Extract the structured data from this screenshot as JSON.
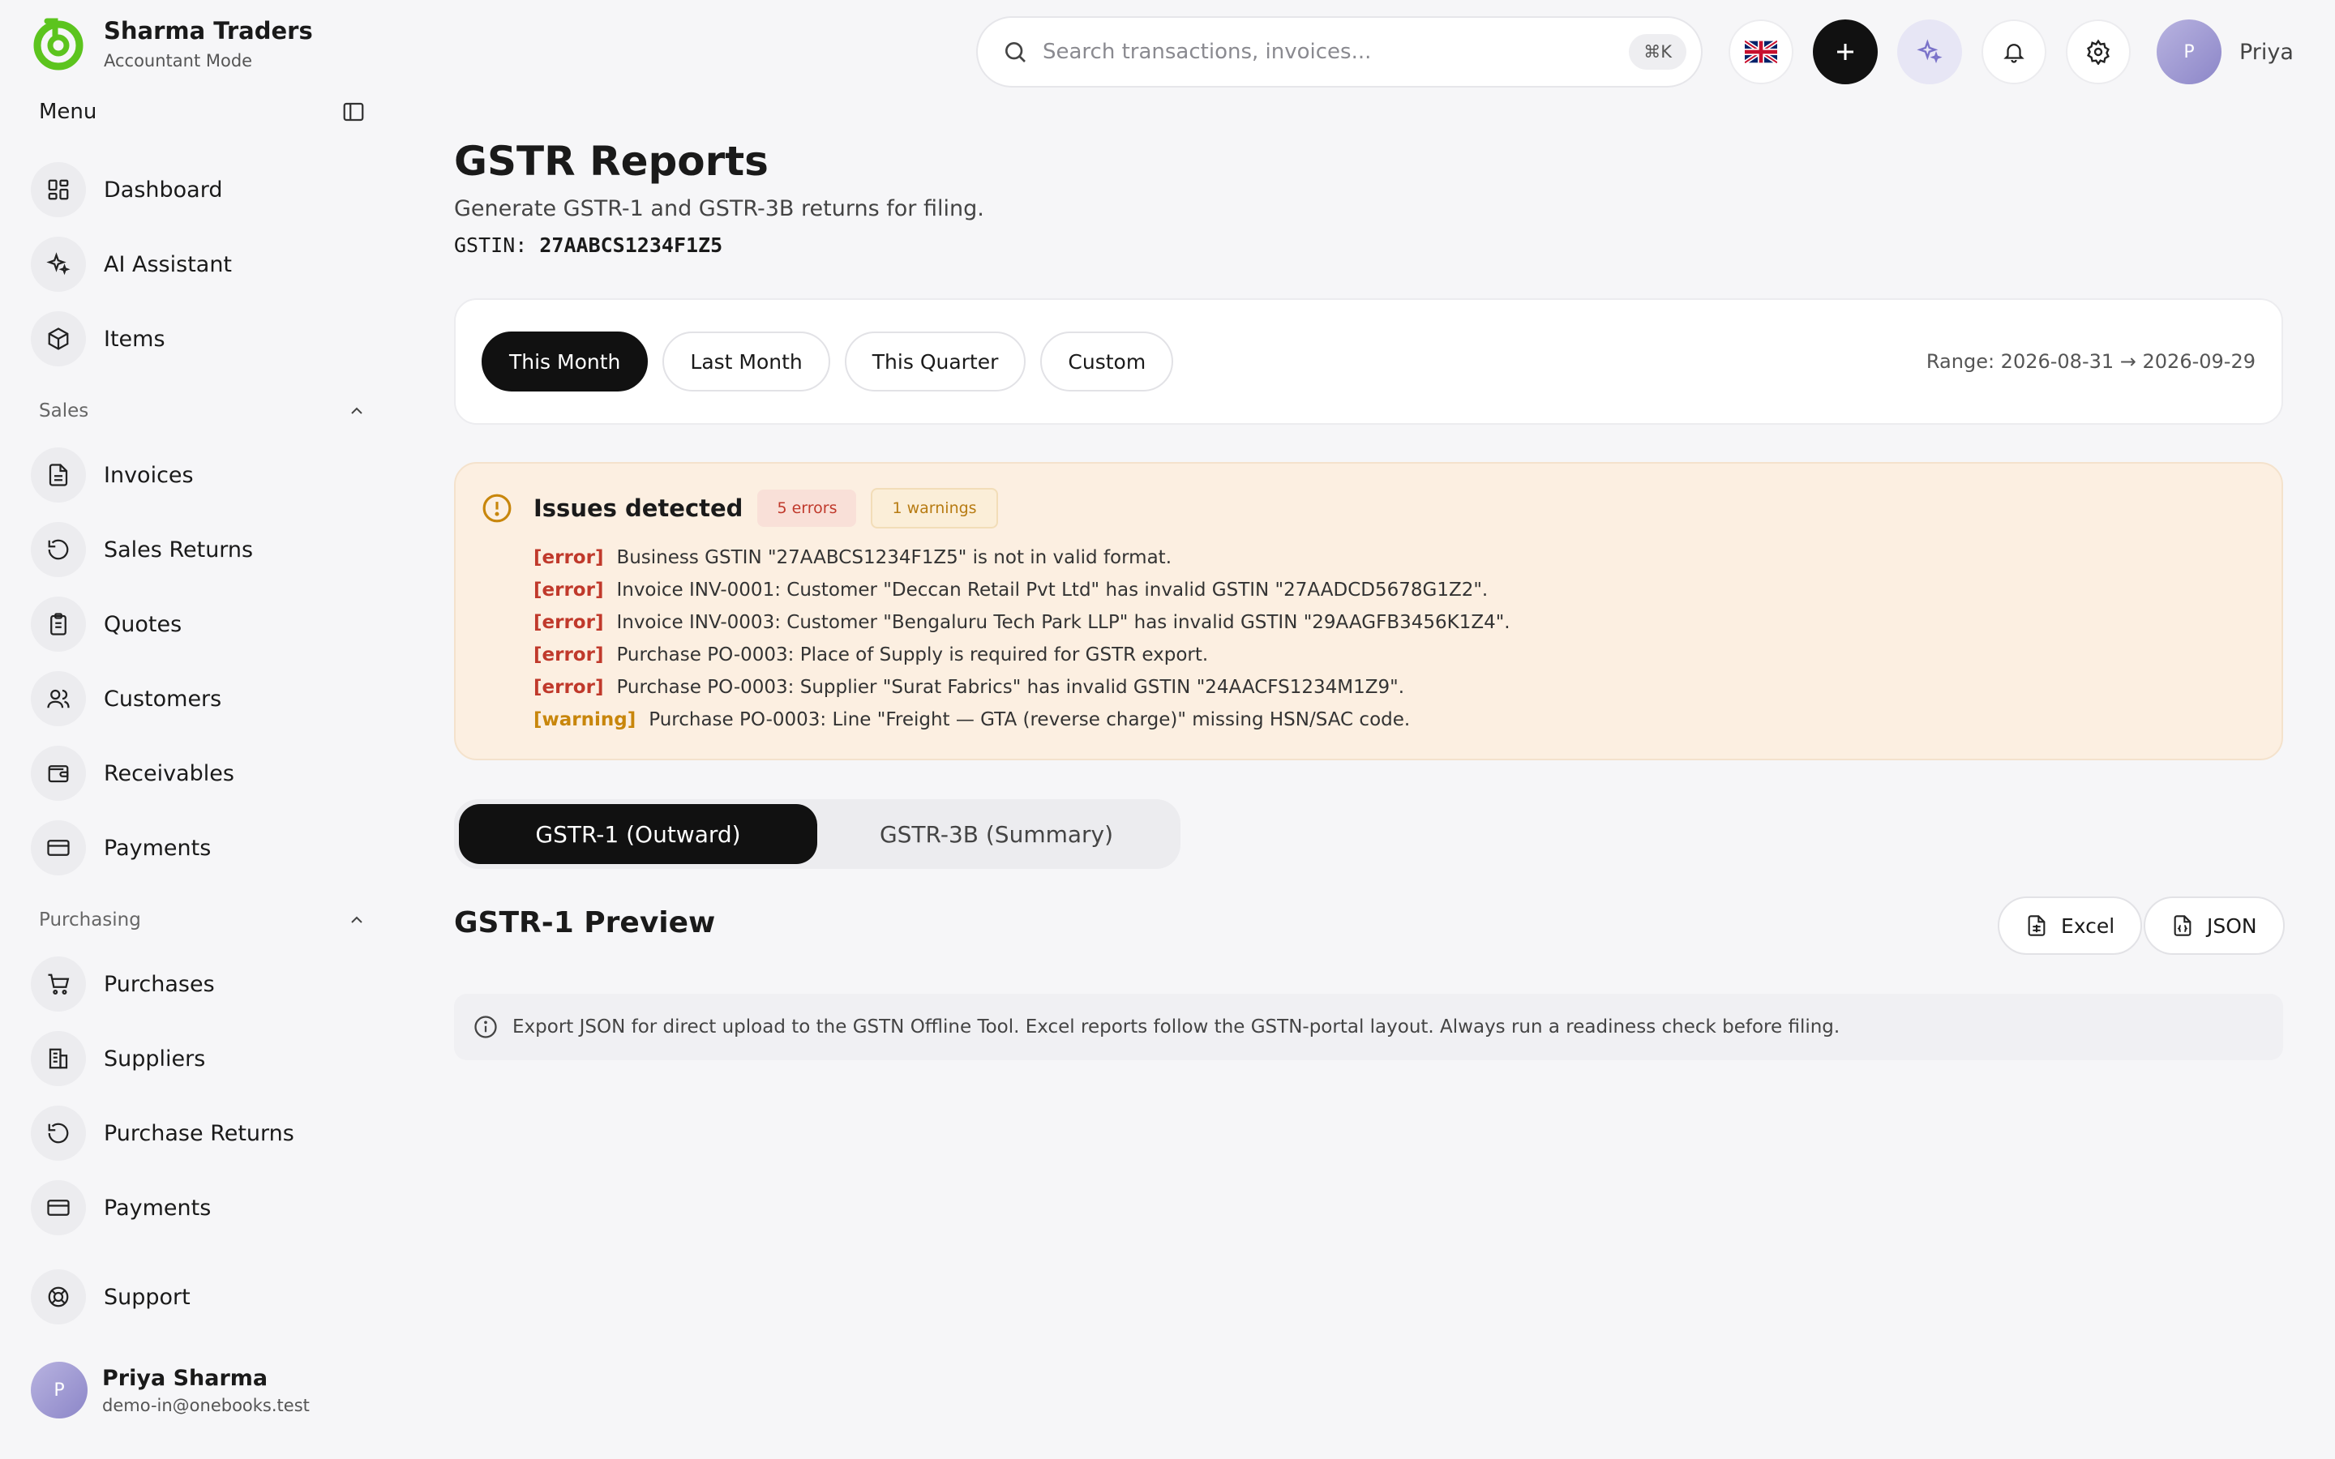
{
  "brand": {
    "name": "Sharma Traders",
    "mode": "Accountant Mode",
    "accent": "#5cc41e"
  },
  "menu": {
    "title": "Menu"
  },
  "nav_top": [
    {
      "label": "Dashboard",
      "icon": "dashboard-icon"
    },
    {
      "label": "AI Assistant",
      "icon": "sparkles-icon"
    },
    {
      "label": "Items",
      "icon": "box-icon"
    }
  ],
  "sales": {
    "label": "Sales",
    "items": [
      {
        "label": "Invoices",
        "icon": "document-icon"
      },
      {
        "label": "Sales Returns",
        "icon": "return-icon"
      },
      {
        "label": "Quotes",
        "icon": "clipboard-icon"
      },
      {
        "label": "Customers",
        "icon": "users-icon"
      },
      {
        "label": "Receivables",
        "icon": "wallet-icon"
      },
      {
        "label": "Payments",
        "icon": "card-icon"
      }
    ]
  },
  "purchasing": {
    "label": "Purchasing",
    "items": [
      {
        "label": "Purchases",
        "icon": "cart-icon"
      },
      {
        "label": "Suppliers",
        "icon": "building-icon"
      },
      {
        "label": "Purchase Returns",
        "icon": "return-icon"
      },
      {
        "label": "Payments",
        "icon": "card-icon"
      }
    ]
  },
  "support": {
    "label": "Support",
    "icon": "lifebuoy-icon"
  },
  "user": {
    "initial": "P",
    "name": "Priya Sharma",
    "email": "demo-in@onebooks.test",
    "short_name": "Priya"
  },
  "search": {
    "placeholder": "Search transactions, invoices...",
    "shortcut": "⌘K"
  },
  "page": {
    "title": "GSTR Reports",
    "subtitle": "Generate GSTR-1 and GSTR-3B returns for filing.",
    "gstin_label": "GSTIN:",
    "gstin_value": "27AABCS1234F1Z5"
  },
  "range": {
    "options": [
      "This Month",
      "Last Month",
      "This Quarter",
      "Custom"
    ],
    "selected": "This Month",
    "text": "Range: 2026-08-31 → 2026-09-29"
  },
  "issues": {
    "title": "Issues detected",
    "errors_badge": "5 errors",
    "warnings_badge": "1 warnings",
    "list": [
      {
        "type": "[error]",
        "text": "Business GSTIN \"27AABCS1234F1Z5\" is not in valid format."
      },
      {
        "type": "[error]",
        "text": "Invoice INV-0001: Customer \"Deccan Retail Pvt Ltd\" has invalid GSTIN \"27AADCD5678G1Z2\"."
      },
      {
        "type": "[error]",
        "text": "Invoice INV-0003: Customer \"Bengaluru Tech Park LLP\" has invalid GSTIN \"29AAGFB3456K1Z4\"."
      },
      {
        "type": "[error]",
        "text": "Purchase PO-0003: Place of Supply is required for GSTR export."
      },
      {
        "type": "[error]",
        "text": "Purchase PO-0003: Supplier \"Surat Fabrics\" has invalid GSTIN \"24AACFS1234M1Z9\"."
      },
      {
        "type": "[warning]",
        "text": "Purchase PO-0003: Line \"Freight — GTA (reverse charge)\" missing HSN/SAC code."
      }
    ]
  },
  "report_tabs": {
    "active": "GSTR-1 (Outward)",
    "inactive": "GSTR-3B (Summary)"
  },
  "preview": {
    "title": "GSTR-1 Preview",
    "excel_label": "Excel",
    "json_label": "JSON"
  },
  "info": {
    "text": "Export JSON for direct upload to the GSTN Offline Tool. Excel reports follow the GSTN-portal layout. Always run a readiness check before filing."
  }
}
